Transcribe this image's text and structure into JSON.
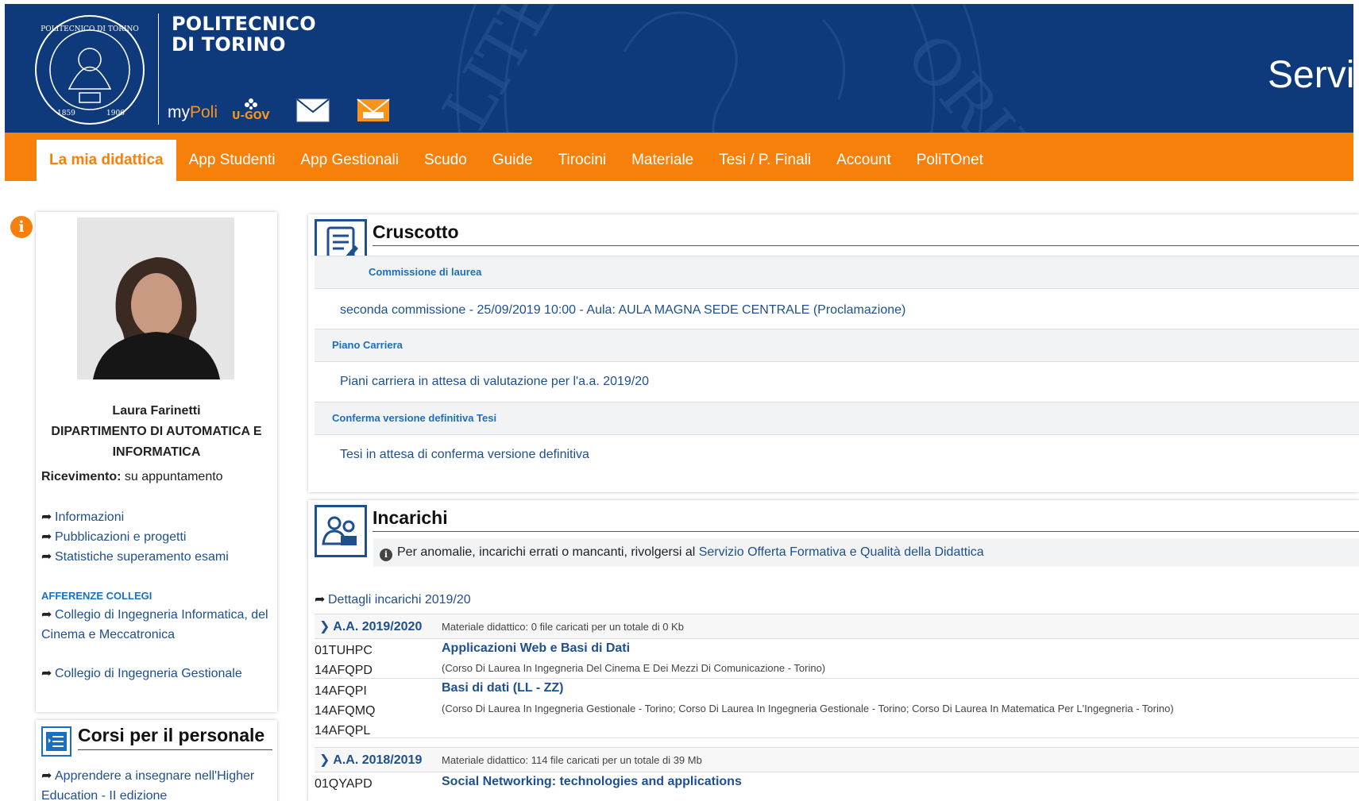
{
  "header": {
    "brand_line1": "POLITECNICO",
    "brand_line2": "DI TORINO",
    "mypoli_prefix": "my",
    "mypoli_suffix": "Poli",
    "ugov_label": "U-GOV",
    "title": "Servi",
    "bg_color": "#0e3a7c",
    "accent": "#f7941d"
  },
  "nav": {
    "items": [
      {
        "label": "La mia didattica",
        "active": true
      },
      {
        "label": "App Studenti"
      },
      {
        "label": "App Gestionali"
      },
      {
        "label": "Scudo"
      },
      {
        "label": "Guide"
      },
      {
        "label": "Tirocini"
      },
      {
        "label": "Materiale"
      },
      {
        "label": "Tesi / P. Finali"
      },
      {
        "label": "Account"
      },
      {
        "label": "PoliTOnet"
      }
    ],
    "bg_color": "#f7800a"
  },
  "profile": {
    "name": "Laura Farinetti",
    "dept_line1": "DIPARTIMENTO DI AUTOMATICA E",
    "dept_line2": "INFORMATICA",
    "ricevimento_label": "Ricevimento:",
    "ricevimento_value": " su appuntamento",
    "links": [
      "Informazioni",
      "Pubblicazioni e progetti",
      "Statistiche superamento esami"
    ],
    "afferenze_title": "AFFERENZE COLLEGI",
    "afferenze": [
      "Collegio di Ingegneria Informatica, del Cinema e Meccatronica",
      "Collegio di Ingegneria Gestionale"
    ]
  },
  "corsi": {
    "title": "Corsi per il personale",
    "links": [
      "Apprendere a insegnare nell'Higher Education - II edizione"
    ]
  },
  "cruscotto": {
    "title": "Cruscotto",
    "sections": [
      {
        "head": "Commissione di laurea",
        "body": "seconda commissione - 25/09/2019 10:00 - Aula: AULA MAGNA SEDE CENTRALE (Proclamazione)"
      },
      {
        "head": "Piano Carriera",
        "body": "Piani carriera in attesa di valutazione per l'a.a. 2019/20"
      },
      {
        "head": "Conferma versione definitiva Tesi",
        "body": "Tesi in attesa di conferma versione definitiva"
      }
    ]
  },
  "incarichi": {
    "title": "Incarichi",
    "note_prefix": "Per anomalie, incarichi errati o mancanti, rivolgersi al ",
    "note_link": "Servizio Offerta Formativa e Qualità della Didattica",
    "dettagli": "Dettagli incarichi 2019/20",
    "years": [
      {
        "year": "A.A. 2019/2020",
        "materiale": "Materiale didattico: 0 file caricati per un totale di 0 Kb"
      },
      {
        "year": "A.A. 2018/2019",
        "materiale": "Materiale didattico: 114 file caricati per un totale di 39 Mb"
      }
    ],
    "courses": [
      {
        "codes": [
          "01TUHPC",
          "14AFQPD"
        ],
        "name": "Applicazioni Web e Basi di Dati",
        "desc": "(Corso Di Laurea In Ingegneria Del Cinema E Dei Mezzi Di Comunicazione - Torino)"
      },
      {
        "codes": [
          "14AFQPI",
          "14AFQMQ",
          "14AFQPL"
        ],
        "name": "Basi di dati (LL - ZZ)",
        "desc": "(Corso Di Laurea In Ingegneria Gestionale - Torino; Corso Di Laurea In Ingegneria Gestionale - Torino; Corso Di Laurea In Matematica Per L'Ingegneria - Torino)"
      },
      {
        "codes": [
          "01QYAPD"
        ],
        "name": "Social Networking: technologies and applications",
        "desc": ""
      }
    ]
  }
}
